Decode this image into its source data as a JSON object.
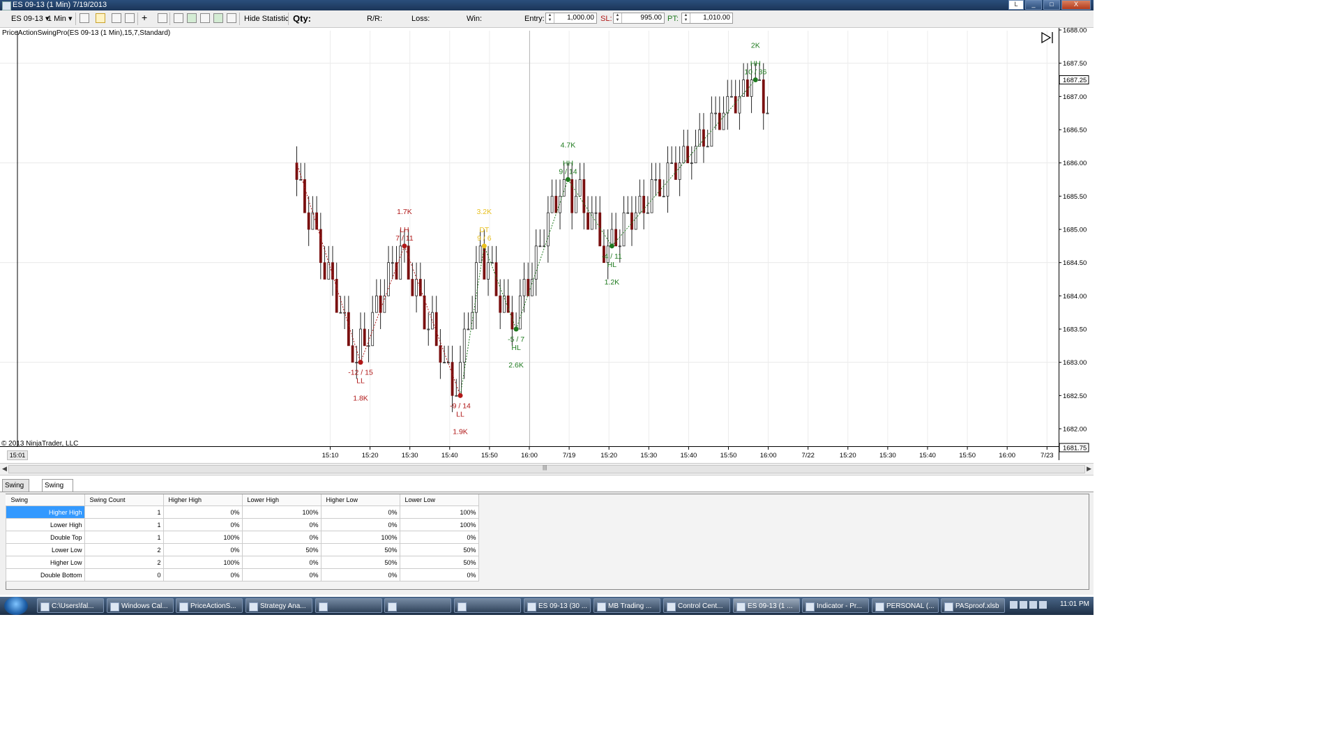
{
  "window": {
    "title": "ES 09-13 (1 Min)  7/19/2013",
    "letter_button": "L",
    "minimize": "_",
    "restore": "□",
    "close": "X"
  },
  "toolbar": {
    "instrument": "ES 09-13",
    "interval": "1 Min",
    "hide_statistic": "Hide Statistic",
    "qty_label": "Qty:",
    "rr_label": "R/R:",
    "loss_label": "Loss:",
    "win_label": "Win:",
    "entry_label": "Entry:",
    "entry_value": "1,000.00",
    "sl_label": "SL:",
    "sl_value": "995.00",
    "pt_label": "PT:",
    "pt_value": "1,010.00",
    "icons": [
      "bar-type-icon",
      "pencil-icon",
      "pin-icon",
      "crosshair-icon",
      "zoom-icon",
      "properties-icon",
      "strategy-icon",
      "data-box-icon",
      "share-icon",
      "template-icon"
    ]
  },
  "chart": {
    "indicator_title": "PriceActionSwingPro(ES 09-13 (1 Min),15,7,Standard)",
    "copyright": "© 2013 NinjaTrader, LLC",
    "x_start_label": "15:01",
    "current_price": "1687.25",
    "last_price": "1681.75",
    "y_ticks": [
      "1688.00",
      "1687.50",
      "1687.00",
      "1686.50",
      "1686.00",
      "1685.50",
      "1685.00",
      "1684.50",
      "1684.00",
      "1683.50",
      "1683.00",
      "1682.50",
      "1682.00"
    ],
    "x_ticks": [
      "15:10",
      "15:20",
      "15:30",
      "15:40",
      "15:50",
      "16:00",
      "7/19",
      "15:20",
      "15:30",
      "15:40",
      "15:50",
      "16:00",
      "7/22",
      "15:20",
      "15:30",
      "15:40",
      "15:50",
      "16:00",
      "7/23"
    ],
    "colors": {
      "bear": "#b01818",
      "bull": "#1f7a1f",
      "double_top": "#e8c020",
      "candle_up": "#333333",
      "candle_down": "#7a1010"
    },
    "swings": [
      {
        "type": "LL",
        "label": "LL",
        "ratio": "-12 / 15",
        "volume": "1.8K",
        "price": 1683.0,
        "color": "bear",
        "pos": "below"
      },
      {
        "type": "LH",
        "label": "LH",
        "ratio": "7 / 11",
        "volume": "1.7K",
        "price": 1684.75,
        "color": "bear",
        "pos": "above"
      },
      {
        "type": "LL",
        "label": "LL",
        "ratio": "-9 / 14",
        "volume": "1.9K",
        "price": 1682.5,
        "color": "bear",
        "pos": "below"
      },
      {
        "type": "DT",
        "label": "DT",
        "ratio": "9 / 6",
        "volume": "3.2K",
        "price": 1684.75,
        "color": "double_top",
        "pos": "above"
      },
      {
        "type": "HL",
        "label": "HL",
        "ratio": "-5 / 7",
        "volume": "2.6K",
        "price": 1683.5,
        "color": "bull",
        "pos": "below"
      },
      {
        "type": "HH",
        "label": "HH",
        "ratio": "9 / 14",
        "volume": "4.7K",
        "price": 1685.75,
        "color": "bull",
        "pos": "above"
      },
      {
        "type": "HL",
        "label": "HL",
        "ratio": "-4 / 11",
        "volume": "1.2K",
        "price": 1684.75,
        "color": "bull",
        "pos": "below"
      },
      {
        "type": "HH",
        "label": "HH",
        "ratio": "10 / 36",
        "volume": "2K",
        "price": 1687.25,
        "color": "bull",
        "pos": "above"
      }
    ]
  },
  "scrollbar": {
    "left": "◀",
    "right": "▶",
    "grip": "|||"
  },
  "tabs": [
    "Swing Length",
    "Swing Relation"
  ],
  "table": {
    "headers": [
      "Swing",
      "Swing Count",
      "Higher High",
      "Lower High",
      "Higher Low",
      "Lower Low"
    ],
    "rows": [
      [
        "Higher High",
        "1",
        "0%",
        "100%",
        "0%",
        "100%"
      ],
      [
        "Lower High",
        "1",
        "0%",
        "0%",
        "0%",
        "100%"
      ],
      [
        "Double Top",
        "1",
        "100%",
        "0%",
        "100%",
        "0%"
      ],
      [
        "Lower Low",
        "2",
        "0%",
        "50%",
        "50%",
        "50%"
      ],
      [
        "Higher Low",
        "2",
        "100%",
        "0%",
        "50%",
        "50%"
      ],
      [
        "Double Bottom",
        "0",
        "0%",
        "0%",
        "0%",
        "0%"
      ]
    ]
  },
  "taskbar": {
    "items": [
      "C:\\Users\\fal...",
      "Windows Cal...",
      "PriceActionS...",
      "Strategy Ana...",
      "",
      "",
      "",
      "ES 09-13 (30 ...",
      "MB Trading ...",
      "Control Cent...",
      "ES 09-13 (1 ...",
      "Indicator - Pr...",
      "PERSONAL (...",
      "PASproof.xlsb"
    ],
    "clock": "11:01 PM"
  }
}
